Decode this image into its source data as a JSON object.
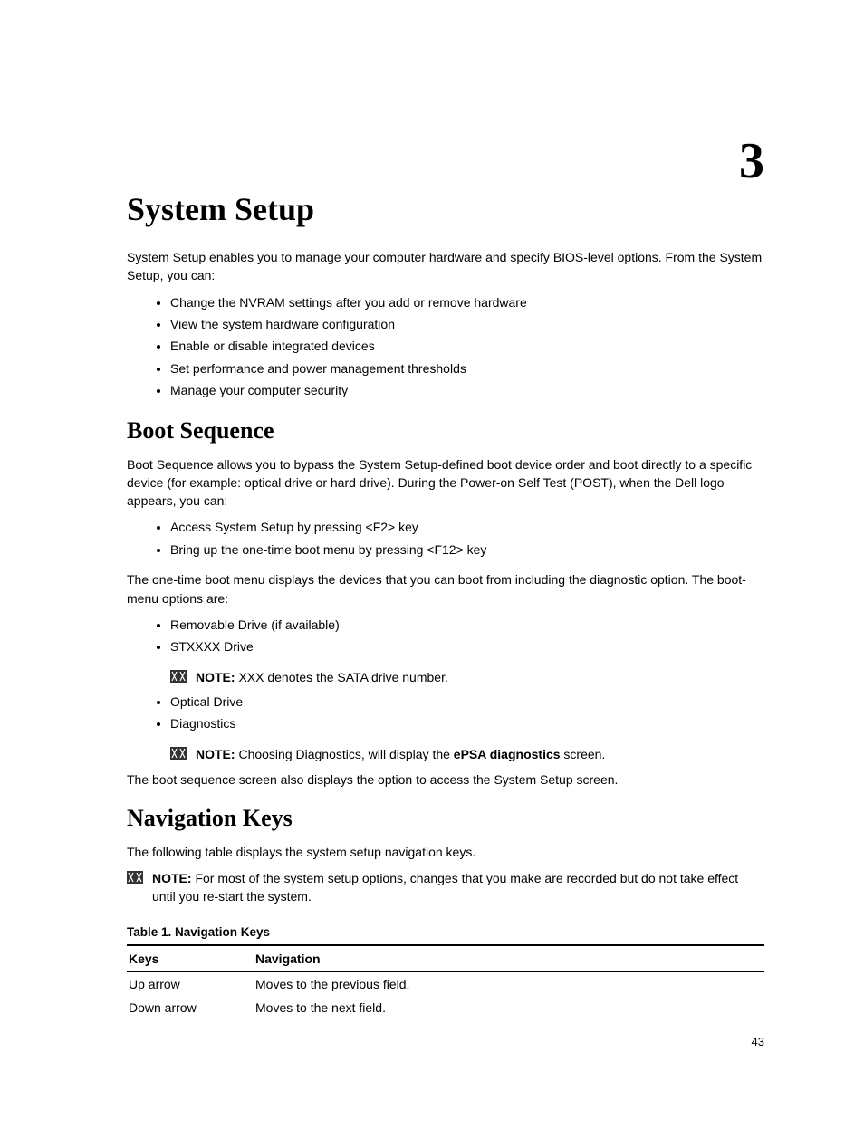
{
  "chapter_number": "3",
  "h1": "System Setup",
  "intro": "System Setup enables you to manage your computer hardware and specify BIOS-level options. From the System Setup, you can:",
  "intro_list": [
    "Change the NVRAM settings after you add or remove hardware",
    "View the system hardware configuration",
    "Enable or disable integrated devices",
    "Set performance and power management thresholds",
    "Manage your computer security"
  ],
  "boot": {
    "heading": "Boot Sequence",
    "para1": "Boot Sequence allows you to bypass the System Setup-defined boot device order and boot directly to a specific device (for example: optical drive or hard drive). During the Power-on Self Test (POST), when the Dell logo appears, you can:",
    "list1": [
      "Access System Setup by pressing <F2> key",
      "Bring up the one-time boot menu by pressing <F12> key"
    ],
    "para2": "The one-time boot menu displays the devices that you can boot from including the diagnostic option. The boot-menu options are:",
    "list2_item1": "Removable Drive (if available)",
    "list2_item2": "STXXXX Drive",
    "note1_label": "NOTE: ",
    "note1_text": "XXX denotes the SATA drive number.",
    "list2_item3": "Optical Drive",
    "list2_item4": "Diagnostics",
    "note2_label": "NOTE: ",
    "note2_pre": "Choosing Diagnostics, will display the ",
    "note2_bold": "ePSA diagnostics",
    "note2_post": " screen.",
    "para3": "The boot sequence screen also displays the option to access the System Setup screen."
  },
  "nav": {
    "heading": "Navigation Keys",
    "para1": "The following table displays the system setup navigation keys.",
    "note_label": "NOTE: ",
    "note_text": "For most of the system setup options, changes that you make are recorded but do not take effect until you re-start the system.",
    "table_caption": "Table 1. Navigation Keys",
    "th_keys": "Keys",
    "th_nav": "Navigation",
    "rows": [
      {
        "key": "Up arrow",
        "nav": "Moves to the previous field."
      },
      {
        "key": "Down arrow",
        "nav": "Moves to the next field."
      }
    ]
  },
  "page_number": "43"
}
